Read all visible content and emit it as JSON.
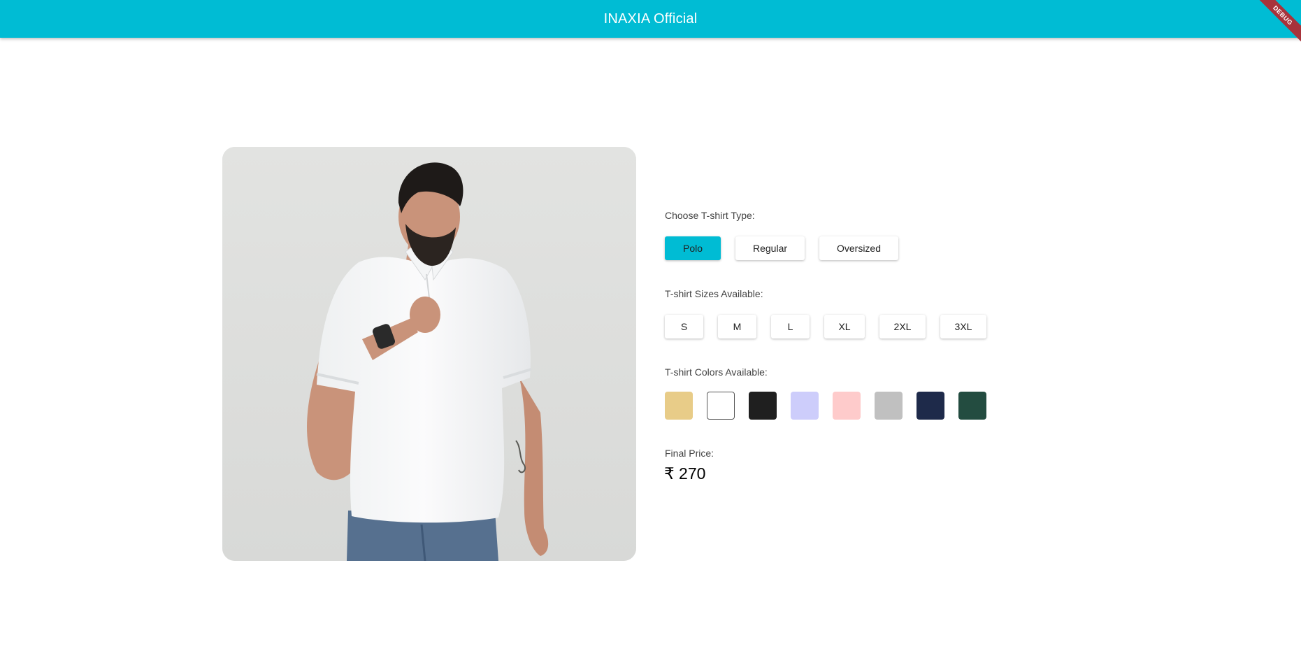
{
  "appbar": {
    "title": "INAXIA Official",
    "debug_banner": "DEBUG",
    "color": "#00bcd4"
  },
  "product": {
    "image_alt": "Man wearing white polo t-shirt"
  },
  "type_section": {
    "label": "Choose T-shirt Type:",
    "options": [
      "Polo",
      "Regular",
      "Oversized"
    ],
    "selected": "Polo"
  },
  "size_section": {
    "label": "T-shirt Sizes Available:",
    "options": [
      "S",
      "M",
      "L",
      "XL",
      "2XL",
      "3XL"
    ]
  },
  "color_section": {
    "label": "T-shirt Colors Available:",
    "swatches": [
      "#e8cc88",
      "#ffffff",
      "#1f1f1f",
      "#cdcdfb",
      "#fecbcb",
      "#c0c0c0",
      "#1e2a4a",
      "#234c40"
    ]
  },
  "price_section": {
    "label": "Final Price:",
    "value": "₹ 270"
  }
}
